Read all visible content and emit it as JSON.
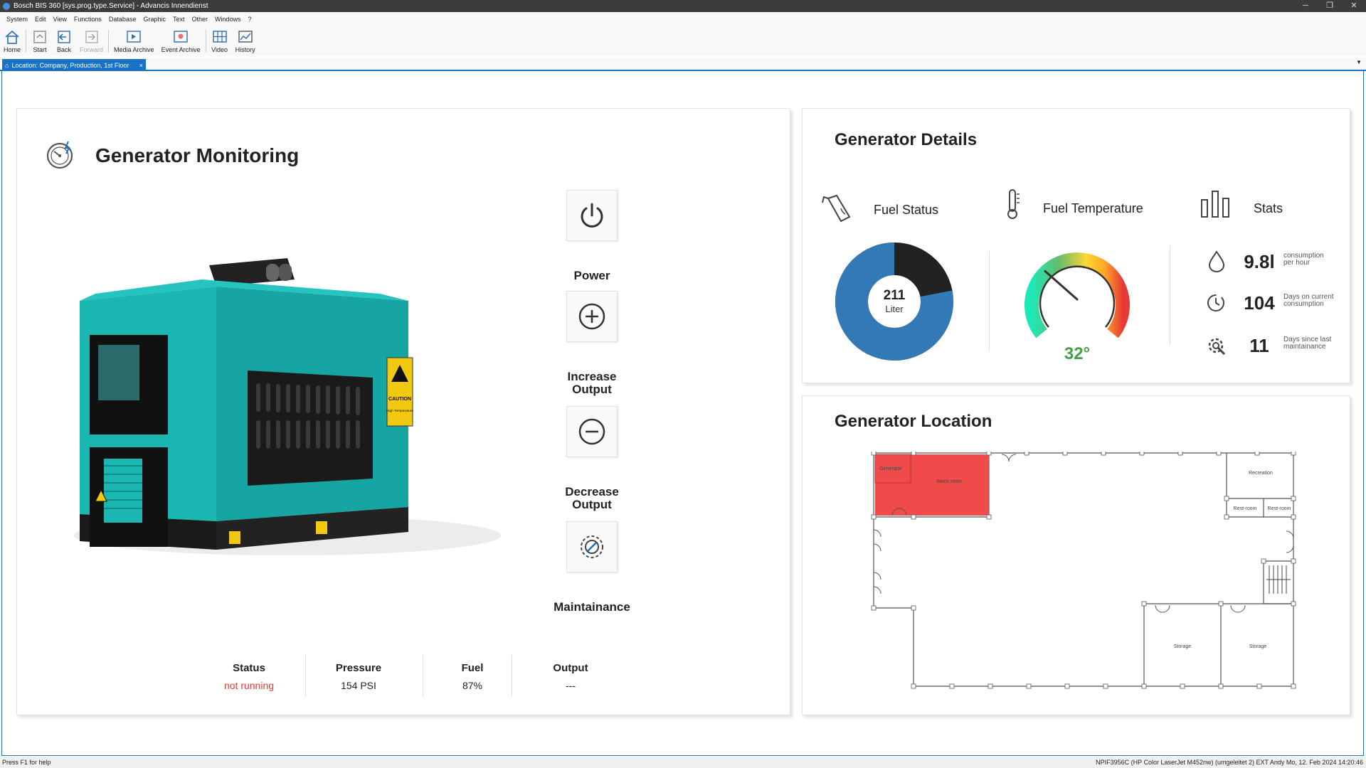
{
  "window": {
    "title": "Bosch BIS 360 [sys.prog.type.Service] - Advancis Innendienst"
  },
  "menu": [
    "System",
    "Edit",
    "View",
    "Functions",
    "Database",
    "Graphic",
    "Text",
    "Other",
    "Windows",
    "?"
  ],
  "toolbar": {
    "home": "Home",
    "start": "Start",
    "back": "Back",
    "forward": "Forward",
    "media": "Media Archive",
    "event": "Event Archive",
    "video": "Video",
    "history": "History"
  },
  "tab": {
    "label": "Location: Company, Production, 1st Floor",
    "close": "×"
  },
  "main": {
    "title": "Generator Monitoring",
    "controls": {
      "power": "Power",
      "increase_l1": "Increase",
      "increase_l2": "Output",
      "decrease_l1": "Decrease",
      "decrease_l2": "Output",
      "maint": "Maintainance"
    },
    "caution": "CAUTION",
    "caution_sub": "High Temperature",
    "status": [
      {
        "label": "Status",
        "value": "not running"
      },
      {
        "label": "Pressure",
        "value": "154 PSI"
      },
      {
        "label": "Fuel",
        "value": "87%"
      },
      {
        "label": "Output",
        "value": "---"
      }
    ]
  },
  "details": {
    "title": "Generator Details",
    "fuel_status": "Fuel Status",
    "fuel_temp": "Fuel Temperature",
    "stats": "Stats",
    "fuel_value": "211",
    "fuel_unit": "Liter",
    "fuel_level": 0.78,
    "temp_value": "32°",
    "temp_level": 0.32,
    "stat_rows": [
      {
        "value": "9.8l",
        "label_l1": "consumption",
        "label_l2": "per hour"
      },
      {
        "value": "104",
        "label_l1": "Days on current",
        "label_l2": "consumption"
      },
      {
        "value": "11",
        "label_l1": "Days since last",
        "label_l2": "maintainance"
      }
    ]
  },
  "location": {
    "title": "Generator Location",
    "rooms": {
      "gen1": "Generator",
      "gen2": "Stock room",
      "recreation": "Recreation",
      "rest1": "Rest-room",
      "rest2": "Rest-room",
      "storage1": "Storage",
      "storage2": "Storage"
    }
  },
  "colors": {
    "accent": "#1a72c4",
    "teal": "#19b6b2",
    "fuel_blue": "#3279b5",
    "alarm": "#e53935",
    "temp_green": "#43a047"
  },
  "statusbar": {
    "left": "Press F1 for help",
    "right": "NPIF3956C (HP Color LaserJet M452nw) (umgeleitet 2)   EXT   Andy   Mo, 12. Feb 2024  14:20:46"
  }
}
